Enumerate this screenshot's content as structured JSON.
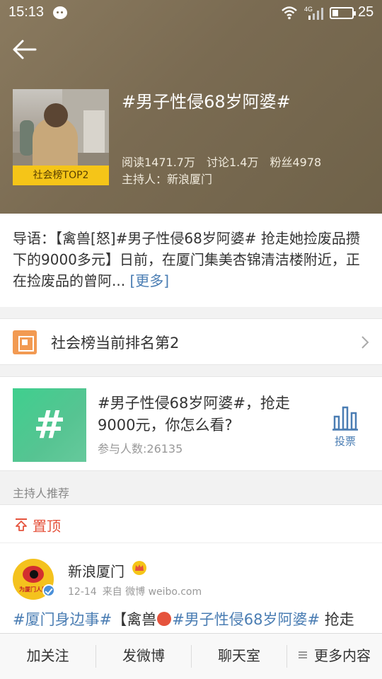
{
  "status_bar": {
    "time": "15:13",
    "network": "4G",
    "battery": "25"
  },
  "topic": {
    "title": "#男子性侵68岁阿婆#",
    "badge": "社会榜TOP2",
    "reads": "阅读1471.7万",
    "discussions": "讨论1.4万",
    "fans": "粉丝4978",
    "host": "主持人：新浪厦门"
  },
  "intro": {
    "text": "导语：【禽兽[怒]#男子性侵68岁阿婆# 抢走她捡废品攒下的9000多元】日前，在厦门集美杏锦清洁楼附近，正在捡废品的曾阿...",
    "more": "[更多]"
  },
  "rank": {
    "text": "社会榜当前排名第2"
  },
  "vote": {
    "symbol": "#",
    "title": "#男子性侵68岁阿婆#，抢走9000元，你怎么看?",
    "participants": "参与人数:26135",
    "button": "投票"
  },
  "section": {
    "label": "主持人推荐"
  },
  "pinned": {
    "label": "置顶"
  },
  "post": {
    "name": "新浪厦门",
    "avatar_text": "为厦门人民",
    "date": "12-14",
    "source": "来自 微博 weibo.com",
    "tag1": "#厦门身边事#",
    "text1": "【禽兽",
    "tag2": "#男子性侵68岁阿婆#",
    "text2": " 抢走"
  },
  "bottom_bar": {
    "follow": "加关注",
    "post": "发微博",
    "chat": "聊天室",
    "more": "更多内容"
  },
  "colors": {
    "link": "#4a7db3",
    "accent_red": "#e5533d",
    "badge_yellow": "#f5c518",
    "rank_orange": "#f29a52",
    "vote_green": "#3fcf8e"
  }
}
